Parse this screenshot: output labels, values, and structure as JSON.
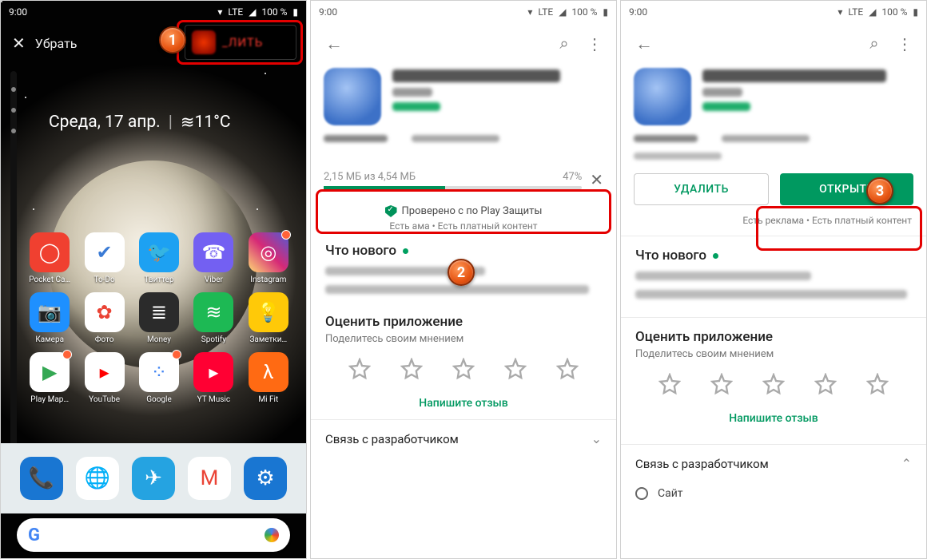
{
  "status": {
    "time": "9:00",
    "net": "LTE",
    "batt": "100 %"
  },
  "panel1": {
    "remove_label": "Убрать",
    "delete_label": "_ЛИТЬ",
    "widget_date": "Среда, 17 апр.",
    "widget_temp": "11°C",
    "apps": [
      {
        "label": "Pocket Ca…",
        "bg": "#f04030",
        "glyph": "◯"
      },
      {
        "label": "To-Do",
        "bg": "#ffffff",
        "glyph": "✔",
        "fg": "#3a7bd5"
      },
      {
        "label": "Твиттер",
        "bg": "#1da1f2",
        "glyph": "🐦"
      },
      {
        "label": "Viber",
        "bg": "#7360f2",
        "glyph": "☎"
      },
      {
        "label": "Instagram",
        "bg": "linear-gradient(45deg,#feda75,#d62976,#4f5bd5)",
        "glyph": "◎",
        "dot": true
      },
      {
        "label": "Камера",
        "bg": "#1e90ff",
        "glyph": "📷"
      },
      {
        "label": "Фото",
        "bg": "#ffffff",
        "glyph": "✿",
        "fg": "#ea4335"
      },
      {
        "label": "Money",
        "bg": "#2b2b2b",
        "glyph": "≣"
      },
      {
        "label": "Spotify",
        "bg": "#1db954",
        "glyph": "≋"
      },
      {
        "label": "Заметки…",
        "bg": "#ffc908",
        "glyph": "💡"
      },
      {
        "label": "Play Мар…",
        "bg": "#ffffff",
        "glyph": "▶",
        "fg": "#34a853",
        "dot": true
      },
      {
        "label": "YouTube",
        "bg": "#ffffff",
        "glyph": "▸",
        "fg": "#ff0000"
      },
      {
        "label": "Google",
        "bg": "#ffffff",
        "glyph": "⁘",
        "fg": "#4285f4",
        "dot": true
      },
      {
        "label": "YT Music",
        "bg": "#ff0033",
        "glyph": "▸"
      },
      {
        "label": "Mi Fit",
        "bg": "#ff6a13",
        "glyph": "λ"
      }
    ],
    "dock": [
      {
        "bg": "#1976d2",
        "glyph": "📞"
      },
      {
        "bg": "#ffffff",
        "glyph": "🌐",
        "fg": "#4285f4"
      },
      {
        "bg": "#25a3e1",
        "glyph": "✈"
      },
      {
        "bg": "#ffffff",
        "glyph": "M",
        "fg": "#ea4335"
      },
      {
        "bg": "#1976d2",
        "glyph": "⚙"
      }
    ],
    "search_g": "G"
  },
  "panel2": {
    "download": {
      "text": "2,15 МБ из 4,54 МБ",
      "pct_label": "47%",
      "pct": 47
    },
    "verify": "Проверено с по             Play Защиты",
    "ads": "Есть        ама • Есть платный контент",
    "whatsnew": "Что нового",
    "rate_h": "Оценить приложение",
    "rate_sub": "Поделитесь своим мнением",
    "write": "Напишите отзыв",
    "dev": "Связь с разработчиком"
  },
  "panel3": {
    "btn_uninstall": "УДАЛИТЬ",
    "btn_open": "ОТКРЫТЬ",
    "ads": "Есть реклама • Есть платный контент",
    "whatsnew": "Что нового",
    "rate_h": "Оценить приложение",
    "rate_sub": "Поделитесь своим мнением",
    "write": "Напишите отзыв",
    "dev": "Связь с разработчиком",
    "site": "Сайт"
  },
  "badges": {
    "b1": "1",
    "b2": "2",
    "b3": "3"
  }
}
